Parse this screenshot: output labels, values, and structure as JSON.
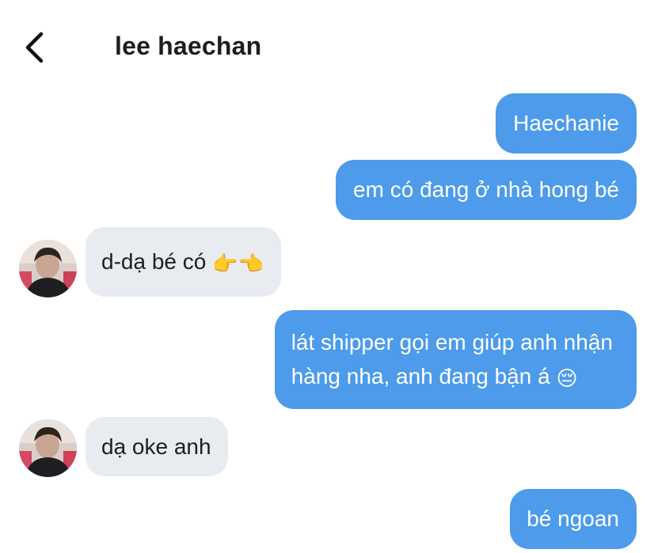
{
  "header": {
    "title": "lee haechan",
    "back_icon": "chevron-left-icon"
  },
  "colors": {
    "outgoing_bubble": "#4d9bea",
    "incoming_bubble": "#e8ebef"
  },
  "messages": [
    {
      "direction": "outgoing",
      "text": "Haechanie"
    },
    {
      "direction": "outgoing",
      "text": "em có đang ở nhà hong bé"
    },
    {
      "direction": "incoming",
      "text": "d-dạ bé có",
      "emoji": "👉👈"
    },
    {
      "direction": "outgoing",
      "lines": [
        "lát shipper gọi em giúp anh nhận",
        "hàng nha, anh đang bận á"
      ],
      "emoji": "😔"
    },
    {
      "direction": "incoming",
      "text": "dạ oke anh"
    },
    {
      "direction": "outgoing",
      "text": "bé ngoan"
    }
  ]
}
